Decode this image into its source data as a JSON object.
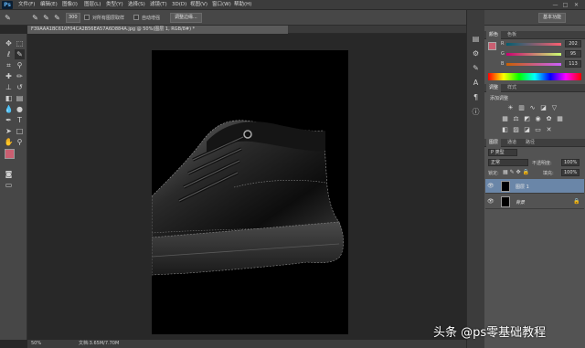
{
  "app": {
    "logo": "Ps"
  },
  "menu": [
    "文件(F)",
    "编辑(E)",
    "图像(I)",
    "图层(L)",
    "类型(Y)",
    "选择(S)",
    "滤镜(T)",
    "3D(D)",
    "视图(V)",
    "窗口(W)",
    "帮助(H)"
  ],
  "window_controls": [
    "—",
    "□",
    "✕"
  ],
  "options_bar": {
    "brush_size": "300",
    "sample_all_layers": "对所有图层取样",
    "auto_enhance": "自动增强",
    "refine_edge_button": "调整边缘...",
    "workspace": "基本功能"
  },
  "document_tab": "F39AAA1BC610F04CA2B56EA57A6D884A.jpg @ 50%(图层 1, RGB/8#) *",
  "status": {
    "zoom": "50%",
    "doc_info": "文档:3.65M/7.70M"
  },
  "color_panel": {
    "tabs": [
      "颜色",
      "色板"
    ],
    "channels": [
      {
        "label": "R",
        "value": "202"
      },
      {
        "label": "G",
        "value": "95"
      },
      {
        "label": "B",
        "value": "113"
      }
    ],
    "foreground_color": "#ca5f71"
  },
  "adjustments_panel": {
    "tabs": [
      "调整",
      "样式"
    ],
    "title": "添加调整"
  },
  "layers_panel": {
    "tabs": [
      "图层",
      "通道",
      "路径"
    ],
    "kind": "P 类型",
    "blend_mode": "正常",
    "opacity_label": "不透明度:",
    "opacity": "100%",
    "lock_label": "锁定:",
    "fill_label": "填充:",
    "fill": "100%",
    "layers": [
      {
        "name": "图层 1",
        "selected": true
      },
      {
        "name": "背景",
        "selected": false
      }
    ]
  },
  "watermark": "头条 @ps零基础教程"
}
